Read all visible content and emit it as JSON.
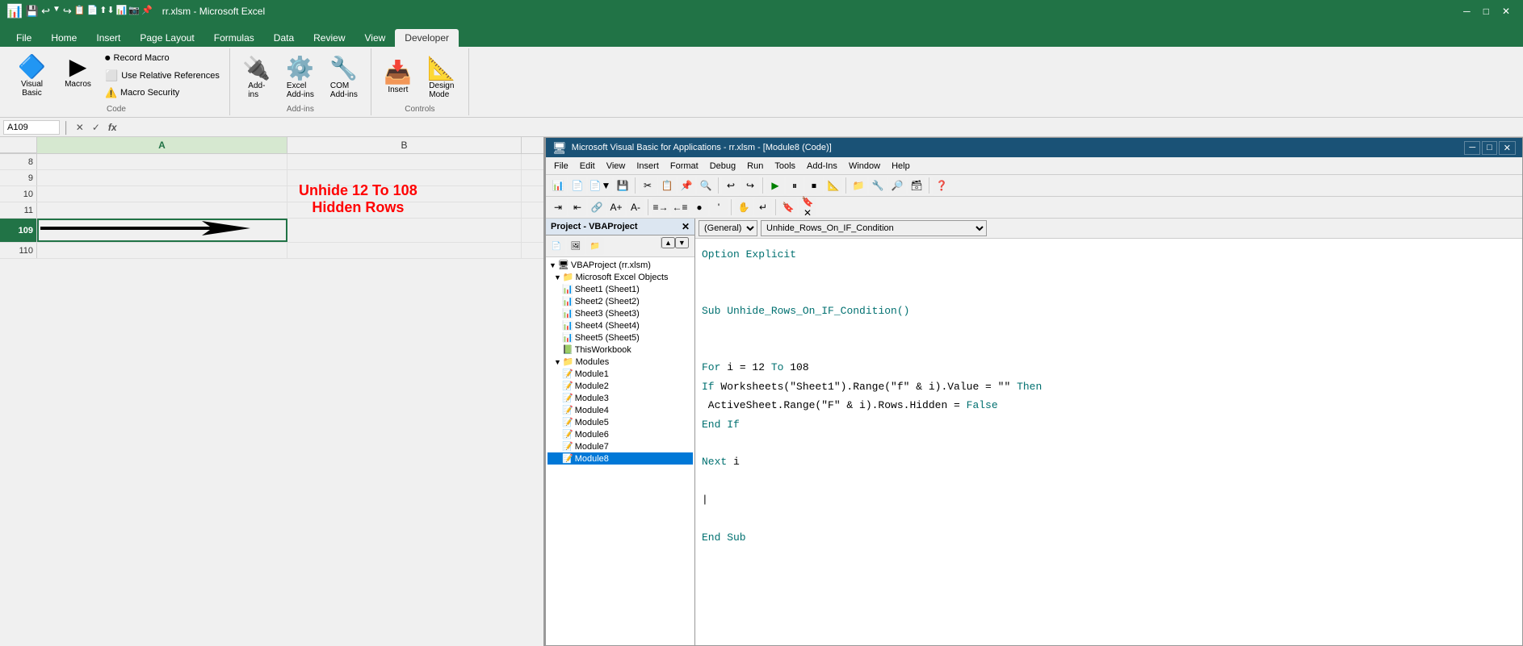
{
  "excel": {
    "title": "Microsoft Excel - rr.xlsm",
    "titlebar": {
      "buttons": [
        "_",
        "□",
        "✕"
      ]
    },
    "tabs": [
      "File",
      "Home",
      "Insert",
      "Page Layout",
      "Formulas",
      "Data",
      "Review",
      "View",
      "Developer"
    ],
    "active_tab": "Developer",
    "ribbon": {
      "code_group": {
        "label": "Code",
        "visual_basic_label": "Visual\nBasic",
        "macros_label": "Macros",
        "record_macro_label": "Record Macro",
        "use_relative_label": "Use Relative References",
        "macro_security_label": "Macro Security"
      },
      "addins_group": {
        "label": "Add-ins",
        "addins_label": "Add-\nins",
        "excel_addins_label": "Excel\nAdd-ins",
        "com_addins_label": "COM\nAdd-ins"
      },
      "controls_group": {
        "label": "Controls",
        "insert_label": "Insert",
        "design_mode_label": "Design\nMode"
      }
    },
    "formula_bar": {
      "name_box": "A109",
      "formula": ""
    },
    "grid": {
      "columns": [
        "A",
        "B"
      ],
      "rows": [
        8,
        9,
        10,
        11,
        109,
        110
      ],
      "active_cell": "A109"
    },
    "annotation": {
      "line1": "Unhide 12 To 108",
      "line2": "Hidden Rows"
    }
  },
  "vba": {
    "title": "Microsoft Visual Basic for Applications - rr.xlsm - [Module8 (Code)]",
    "menu_items": [
      "File",
      "Edit",
      "View",
      "Insert",
      "Format",
      "Debug",
      "Run",
      "Tools",
      "Add-Ins",
      "Window",
      "Help"
    ],
    "project_panel": {
      "title": "Project - VBAProject",
      "vbaproject_label": "VBAProject (rr.xlsm)",
      "excel_objects_label": "Microsoft Excel Objects",
      "sheets": [
        "Sheet1 (Sheet1)",
        "Sheet2 (Sheet2)",
        "Sheet3 (Sheet3)",
        "Sheet4 (Sheet4)",
        "Sheet5 (Sheet5)",
        "ThisWorkbook"
      ],
      "modules_label": "Modules",
      "modules": [
        "Module1",
        "Module2",
        "Module3",
        "Module4",
        "Module5",
        "Module6",
        "Module7",
        "Module8"
      ]
    },
    "code_editor": {
      "dropdown_left": "(General)",
      "dropdown_right": "Unhide_Rows_On_IF_Condition",
      "code_lines": [
        {
          "text": "Option Explicit",
          "class": "kw-teal"
        },
        {
          "text": "",
          "class": "code-normal"
        },
        {
          "text": "",
          "class": "code-normal"
        },
        {
          "text": "Sub Unhide_Rows_On_IF_Condition()",
          "class": "kw-teal"
        },
        {
          "text": "",
          "class": "code-normal"
        },
        {
          "text": "",
          "class": "code-normal"
        },
        {
          "text": "For i = 12 To 108",
          "class": "mixed"
        },
        {
          "text": "If Worksheets(\"Sheet1\").Range(\"f\" & i).Value = \"\" Then",
          "class": "mixed"
        },
        {
          "text": " ActiveSheet.Range(\"F\" & i).Rows.Hidden = False",
          "class": "mixed"
        },
        {
          "text": "End If",
          "class": "kw-teal"
        },
        {
          "text": "",
          "class": "code-normal"
        },
        {
          "text": "Next i",
          "class": "kw-teal"
        },
        {
          "text": "",
          "class": "code-normal"
        },
        {
          "text": "|",
          "class": "code-normal"
        },
        {
          "text": "",
          "class": "code-normal"
        },
        {
          "text": "End Sub",
          "class": "kw-teal"
        }
      ]
    }
  }
}
